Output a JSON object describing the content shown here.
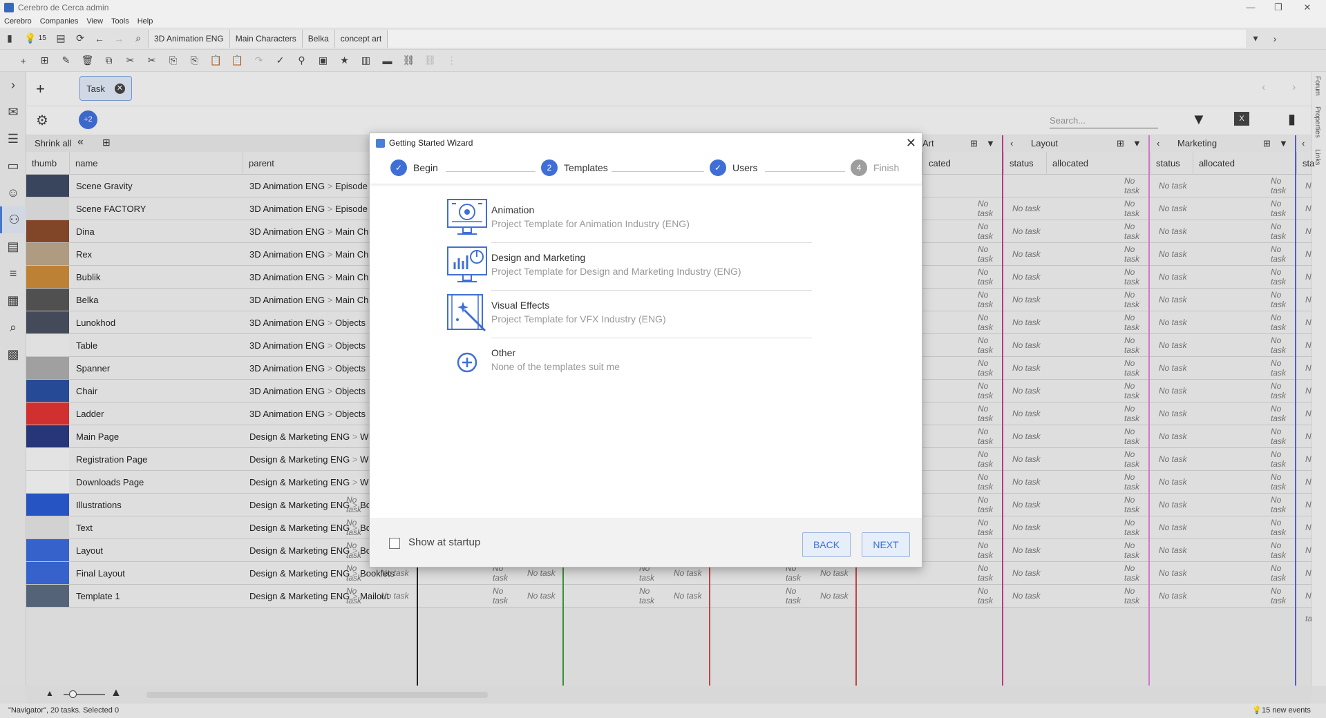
{
  "window": {
    "title": "Cerebro de Cerca  admin"
  },
  "menu": [
    "Cerebro",
    "Companies",
    "View",
    "Tools",
    "Help"
  ],
  "crumbs": {
    "count": "15",
    "items": [
      "3D Animation ENG",
      "Main Characters",
      "Belka",
      "concept art"
    ]
  },
  "filter": {
    "chip": "Task",
    "extra": "+2",
    "search_placeholder": "Search..."
  },
  "grid": {
    "shrink_all": "Shrink all",
    "columns": {
      "thumb": "thumb",
      "name": "name",
      "parent": "parent"
    },
    "groups": [
      {
        "name": "Art",
        "status": "status",
        "allocated": "cated",
        "color": "#c94a4a"
      },
      {
        "name": "Layout",
        "status": "status",
        "allocated": "allocated",
        "color": "#c73a8a"
      },
      {
        "name": "Marketing",
        "status": "status",
        "allocated": "allocated",
        "color": "#e07fd6"
      },
      {
        "name": "",
        "status": "sta",
        "allocated": "",
        "color": "#5a5ee0"
      }
    ],
    "no_task_a": "No",
    "no_task_b": "task",
    "no_task": "No task",
    "rows": [
      {
        "name": "Scene Gravity",
        "parent_a": "3D Animation ENG",
        "parent_b": "Episode"
      },
      {
        "name": "Scene FACTORY",
        "parent_a": "3D Animation ENG",
        "parent_b": "Episode"
      },
      {
        "name": "Dina",
        "parent_a": "3D Animation ENG",
        "parent_b": "Main Ch"
      },
      {
        "name": "Rex",
        "parent_a": "3D Animation ENG",
        "parent_b": "Main Ch"
      },
      {
        "name": "Bublik",
        "parent_a": "3D Animation ENG",
        "parent_b": "Main Ch"
      },
      {
        "name": "Belka",
        "parent_a": "3D Animation ENG",
        "parent_b": "Main Ch"
      },
      {
        "name": "Lunokhod",
        "parent_a": "3D Animation ENG",
        "parent_b": "Objects"
      },
      {
        "name": "Table",
        "parent_a": "3D Animation ENG",
        "parent_b": "Objects"
      },
      {
        "name": "Spanner",
        "parent_a": "3D Animation ENG",
        "parent_b": "Objects"
      },
      {
        "name": "Chair",
        "parent_a": "3D Animation ENG",
        "parent_b": "Objects"
      },
      {
        "name": "Ladder",
        "parent_a": "3D Animation ENG",
        "parent_b": "Objects"
      },
      {
        "name": "Main Page",
        "parent_a": "Design & Marketing ENG",
        "parent_b": "W"
      },
      {
        "name": "Registration Page",
        "parent_a": "Design & Marketing ENG",
        "parent_b": "W"
      },
      {
        "name": "Downloads Page",
        "parent_a": "Design & Marketing ENG",
        "parent_b": "W"
      },
      {
        "name": "Illustrations",
        "parent_a": "Design & Marketing ENG",
        "parent_b": "Booklets"
      },
      {
        "name": "Text",
        "parent_a": "Design & Marketing ENG",
        "parent_b": "Booklets"
      },
      {
        "name": "Layout",
        "parent_a": "Design & Marketing ENG",
        "parent_b": "Booklets"
      },
      {
        "name": "Final Layout",
        "parent_a": "Design & Marketing ENG",
        "parent_b": "Booklets"
      },
      {
        "name": "Template 1",
        "parent_a": "Design & Marketing ENG",
        "parent_b": "Mailout"
      }
    ]
  },
  "right_panel": [
    "Forum",
    "Properties",
    "Links"
  ],
  "status": {
    "left": "\"Navigator\", 20 tasks. Selected 0",
    "right": "15 new events"
  },
  "wizard": {
    "title": "Getting Started Wizard",
    "steps": [
      {
        "num": "",
        "label": "Begin",
        "done": true
      },
      {
        "num": "2",
        "label": "Templates",
        "done": false
      },
      {
        "num": "",
        "label": "Users",
        "done": true
      },
      {
        "num": "4",
        "label": "Finish",
        "done": false
      }
    ],
    "templates": [
      {
        "name": "Animation",
        "desc": "Project Template for Animation Industry (ENG)",
        "icon": "animation-monitor-icon"
      },
      {
        "name": "Design and Marketing",
        "desc": "Project Template for Design and Marketing Industry (ENG)",
        "icon": "chart-monitor-icon"
      },
      {
        "name": "Visual Effects",
        "desc": "Project Template for VFX Industry (ENG)",
        "icon": "vfx-wand-icon"
      },
      {
        "name": "Other",
        "desc": "None of the templates suit me",
        "icon": "plus-circle-icon"
      }
    ],
    "show_at_startup": "Show at startup",
    "back": "BACK",
    "next": "NEXT"
  },
  "colors": {
    "accent": "#3f6fd6",
    "primary_text": "#333333",
    "muted_text": "#999999"
  }
}
